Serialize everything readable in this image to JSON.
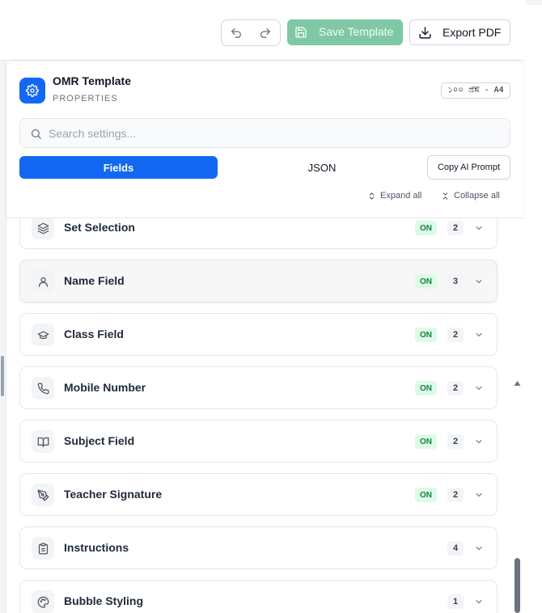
{
  "toolbar": {
    "undo_icon": "undo-icon",
    "redo_icon": "redo-icon",
    "save_label": "Save Template",
    "export_label": "Export PDF",
    "save_bg": "#7fc8a5",
    "accent": "#1268f3"
  },
  "panel": {
    "title": "OMR Template",
    "subtitle": "PROPERTIES",
    "paper_badge": "১০০ প্রশ্ন - A4",
    "search_placeholder": "Search settings...",
    "tabs": [
      {
        "label": "Fields",
        "active": true
      },
      {
        "label": "JSON",
        "active": false
      }
    ],
    "copy_ai_label": "Copy AI Prompt",
    "expand_all": "Expand all",
    "collapse_all": "Collapse all"
  },
  "sections": [
    {
      "label": "Set Selection",
      "icon": "layers-icon",
      "status": "ON",
      "count": "2"
    },
    {
      "label": "Name Field",
      "icon": "user-icon",
      "status": "ON",
      "count": "3"
    },
    {
      "label": "Class Field",
      "icon": "graduation-cap-icon",
      "status": "ON",
      "count": "2"
    },
    {
      "label": "Mobile Number",
      "icon": "phone-icon",
      "status": "ON",
      "count": "2"
    },
    {
      "label": "Subject Field",
      "icon": "book-icon",
      "status": "ON",
      "count": "2"
    },
    {
      "label": "Teacher Signature",
      "icon": "pen-tool-icon",
      "status": "ON",
      "count": "2"
    },
    {
      "label": "Instructions",
      "icon": "clipboard-icon",
      "status": "",
      "count": "4"
    },
    {
      "label": "Bubble Styling",
      "icon": "palette-icon",
      "status": "",
      "count": "1"
    }
  ]
}
